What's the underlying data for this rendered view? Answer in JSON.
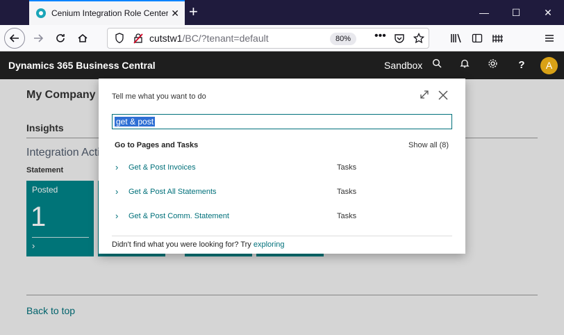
{
  "browser": {
    "tab_title": "Cenium Integration Role Center",
    "url_host": "cutstw1",
    "url_path": "/BC/?tenant=default",
    "zoom": "80%",
    "new_tab_glyph": "+",
    "close_glyph": "✕"
  },
  "app": {
    "title": "Dynamics 365 Business Central",
    "environment": "Sandbox",
    "avatar_initial": "A",
    "help_glyph": "?"
  },
  "page": {
    "company": "My Company",
    "insights": "Insights",
    "integration_heading": "Integration Activities",
    "statement_label": "Statement",
    "tiles": [
      {
        "label": "Posted",
        "value": "1"
      }
    ],
    "back_to_top": "Back to top"
  },
  "tellme": {
    "title": "Tell me what you want to do",
    "query": "get & post",
    "section": "Go to Pages and Tasks",
    "show_all": "Show all (8)",
    "results": [
      {
        "label": "Get & Post Invoices",
        "type": "Tasks"
      },
      {
        "label": "Get & Post All Statements",
        "type": "Tasks"
      },
      {
        "label": "Get & Post Comm. Statement",
        "type": "Tasks"
      }
    ],
    "footer_text": "Didn't find what you were looking for? Try ",
    "footer_link": "exploring"
  },
  "colors": {
    "accent": "#00707a",
    "tile": "#008489",
    "appbar": "#1e1e1e",
    "avatar": "#d8a116"
  }
}
